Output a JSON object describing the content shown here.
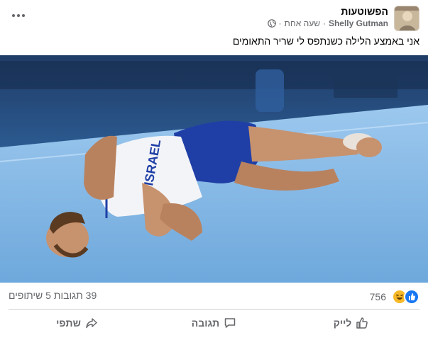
{
  "post": {
    "group_name": "הפשוטעות",
    "author": "Shelly Gutman",
    "separator": "·",
    "time": "שעה אחת",
    "caption": "אני באמצע הלילה כשנתפס לי שריר התאומים"
  },
  "photo": {
    "jersey_text": "ISRAEL"
  },
  "stats": {
    "reaction_count": "756",
    "comments_shares": "39 תגובות  5 שיתופים"
  },
  "actions": {
    "like": "לייק",
    "comment": "תגובה",
    "share": "שתפי"
  },
  "colors": {
    "accent": "#1877f2",
    "secondary_text": "#65676b",
    "haha": "#f7b928"
  },
  "icons": [
    "globe-icon",
    "more-icon",
    "like-reaction-icon",
    "haha-reaction-icon",
    "like-icon",
    "comment-icon",
    "share-icon"
  ]
}
